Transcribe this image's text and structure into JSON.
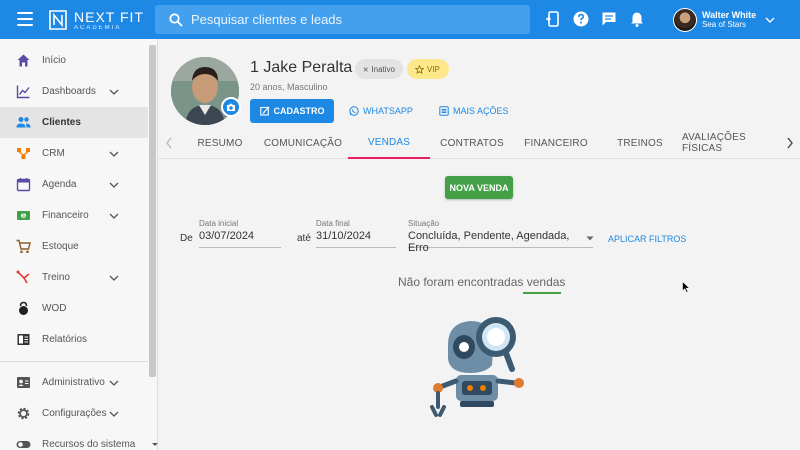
{
  "app": {
    "logo_main": "NEXT FIT",
    "logo_sub": "ACADEMIA"
  },
  "search": {
    "placeholder": "Pesquisar clientes e leads"
  },
  "topbar_icons": [
    "mobile-icon",
    "help-icon",
    "chat-icon",
    "bell-icon"
  ],
  "user": {
    "name": "Walter White",
    "subtitle": "Sea of Stars"
  },
  "sidebar": {
    "items": [
      {
        "label": "Início",
        "icon": "home-icon",
        "has_chevron": false,
        "active": false
      },
      {
        "label": "Dashboards",
        "icon": "chart-icon",
        "has_chevron": true,
        "active": false
      },
      {
        "label": "Clientes",
        "icon": "people-icon",
        "has_chevron": false,
        "active": true
      },
      {
        "label": "CRM",
        "icon": "crm-icon",
        "has_chevron": true,
        "active": false
      },
      {
        "label": "Agenda",
        "icon": "calendar-icon",
        "has_chevron": true,
        "active": false
      },
      {
        "label": "Financeiro",
        "icon": "money-icon",
        "has_chevron": true,
        "active": false
      },
      {
        "label": "Estoque",
        "icon": "cart-icon",
        "has_chevron": false,
        "active": false
      },
      {
        "label": "Treino",
        "icon": "treino-icon",
        "has_chevron": true,
        "active": false
      },
      {
        "label": "WOD",
        "icon": "kettlebell-icon",
        "has_chevron": false,
        "active": false
      },
      {
        "label": "Relatórios",
        "icon": "report-icon",
        "has_chevron": false,
        "active": false
      },
      {
        "label": "Administrativo",
        "icon": "admin-icon",
        "has_chevron": true,
        "active": false
      },
      {
        "label": "Configurações",
        "icon": "gear-icon",
        "has_chevron": true,
        "active": false
      },
      {
        "label": "Recursos do sistema",
        "icon": "toggle-icon",
        "has_chevron": true,
        "active": false
      }
    ]
  },
  "client": {
    "name": "1 Jake Peralta",
    "subtitle": "20 anos, Masculino",
    "status_chip": "Inativo",
    "vip_chip": "VIP"
  },
  "actions": {
    "cadastro": "CADASTRO",
    "whatsapp": "WHATSAPP",
    "mais_acoes": "MAIS AÇÕES"
  },
  "tabs": [
    "RESUMO",
    "COMUNICAÇÃO",
    "VENDAS",
    "CONTRATOS",
    "FINANCEIRO",
    "TREINOS",
    "AVALIAÇÕES FÍSICAS"
  ],
  "active_tab": "VENDAS",
  "sales": {
    "new_sale_label": "NOVA VENDA",
    "filter": {
      "de_label": "De",
      "ate_label": "até",
      "start_label": "Data inicial",
      "start_value": "03/07/2024",
      "end_label": "Data final",
      "end_value": "31/10/2024",
      "situation_label": "Situação",
      "situation_value": "Concluída, Pendente, Agendada, Erro",
      "apply_label": "APLICAR FILTROS"
    },
    "empty_message": "Não foram encontradas vendas"
  },
  "colors": {
    "primary": "#1e88e5",
    "success": "#43a047",
    "tab_indicator": "#e91e63",
    "vip": "#fde98b"
  }
}
